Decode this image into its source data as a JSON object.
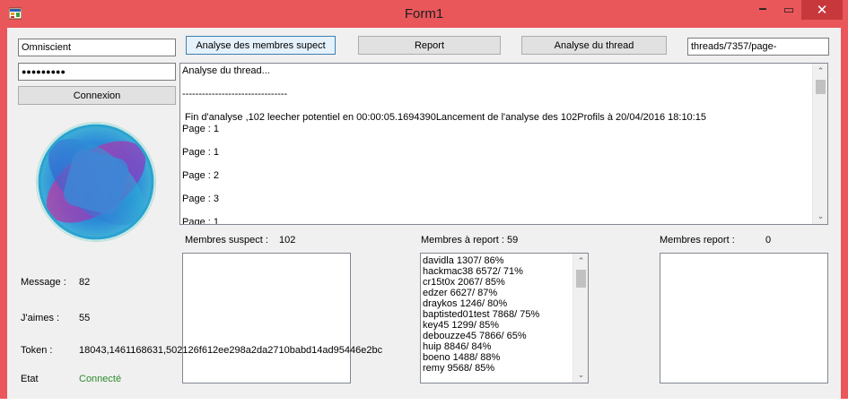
{
  "window": {
    "title": "Form1",
    "minimize_glyph": "🗕",
    "maximize_glyph": "▭",
    "close_glyph": "✕",
    "accent": "#e9575b",
    "close_bg": "#c7383c"
  },
  "login": {
    "username_value": "Omniscient",
    "password_value": "●●●●●●●●●",
    "connect_label": "Connexion"
  },
  "toolbar": {
    "analyse_members_label": "Analyse des membres supect",
    "report_label": "Report",
    "analyse_thread_label": "Analyse du thread",
    "thread_url_value": "threads/7357/page-"
  },
  "log": {
    "lines": [
      "Analyse du thread...",
      "",
      "--------------------------------",
      "",
      " Fin d'analyse ,102 leecher potentiel en 00:00:05.1694390Lancement de l'analyse des 102Profils à 20/04/2016 18:10:15",
      "Page : 1",
      "",
      "Page : 1",
      "",
      "Page : 2",
      "",
      "Page : 3",
      "",
      "Page : 1"
    ]
  },
  "stats": {
    "message_label": "Message :",
    "message_value": "82",
    "likes_label": "J'aimes :",
    "likes_value": "55",
    "token_label": "Token :",
    "token_value": "18043,1461168631,502126f612ee298a2da2710babd14ad95446e2bc",
    "state_label": "Etat",
    "state_value": "Connecté",
    "state_color": "#2e8b2e"
  },
  "suspects": {
    "label": "Membres suspect :",
    "count": "102",
    "items": []
  },
  "to_report": {
    "label": "Membres  à report : 59",
    "items": [
      "davidla 1307/ 86%",
      "hackmac38 6572/ 71%",
      "cr15t0x 2067/ 85%",
      "edzer 6627/ 87%",
      "draykos 1246/ 80%",
      "baptisted01test 7868/ 75%",
      "key45 1299/ 85%",
      "debouzze45 7866/ 65%",
      "huip 8846/ 84%",
      "boeno 1488/ 88%",
      "remy 9568/ 85%"
    ]
  },
  "reported": {
    "label": "Membres report :",
    "count": "0",
    "items": []
  },
  "icons": {
    "up_arrow": "⌃",
    "down_arrow": "⌄"
  }
}
